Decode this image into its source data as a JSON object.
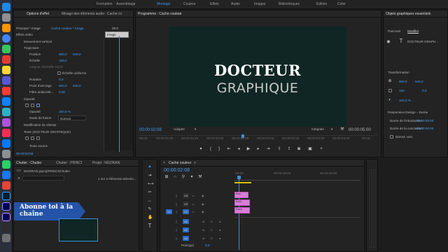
{
  "workspace": {
    "tabs": [
      "Formation",
      "Assemblage",
      "Montage",
      "Couleur",
      "Effets",
      "Audio",
      "Images",
      "Bibliothèques",
      "Edition",
      "Color"
    ],
    "active": "Montage"
  },
  "effect_controls": {
    "tabs": [
      "Options d'effet",
      "Mixage des éléments audio : Cache co"
    ],
    "source": "Principal * Image",
    "sequence": "Cache couleur * Image",
    "timecode_start": "00:0",
    "tooltip": "Image",
    "section": "Effets vidéo",
    "rows": [
      {
        "label": "Mouvement vertical",
        "value": ""
      },
      {
        "label": "Trajectoire",
        "value": ""
      },
      {
        "label": "Position",
        "value": "960,0",
        "value2": "540,0"
      },
      {
        "label": "Échelle",
        "value": "100,0",
        "value2": ""
      },
      {
        "label": "Largeur d'échelle 100,0",
        "value": "",
        "value2": ""
      },
      {
        "label": "",
        "value": "Échelle uniforme",
        "value2": ""
      },
      {
        "label": "Rotation",
        "value": "0,0",
        "value2": ""
      },
      {
        "label": "Point d'ancrage",
        "value": "960,0",
        "value2": "540,0"
      },
      {
        "label": "Filtre antiscintil...",
        "value": "0,00",
        "value2": ""
      },
      {
        "label": "Opacité",
        "value": "",
        "value2": ""
      },
      {
        "label": "Opacité",
        "value": "100,0 %",
        "value2": ""
      },
      {
        "label": "Mode de fusion",
        "value": "Normal",
        "value2": ""
      },
      {
        "label": "Modification de vitesse",
        "value": "",
        "value2": ""
      },
      {
        "label": "Texte (DOCTEUR GRAPHIQUE)",
        "value": "",
        "value2": ""
      },
      {
        "label": "Texte source",
        "value": "",
        "value2": ""
      }
    ],
    "footer_tc": "00:00:02:08"
  },
  "program": {
    "title": "Programme : Cache couleur",
    "menu_icon": "≡",
    "title_line1": "DOCTEUR",
    "title_line2": "GRAPHIQUE",
    "ruler": [
      "00:00",
      "00:00:01:00",
      "00:00:01:25",
      "00:00:02:00",
      "00:00:02:25",
      "00:00:03:00",
      "00:00:03:25",
      "00:00:04:00",
      "00:00:04:25",
      "00:00"
    ],
    "timecode": "00:00:02:08",
    "fit": "Adapter",
    "quality": "Intégrale",
    "duration": "00:00:05:00"
  },
  "project": {
    "tabs": [
      "Chutier : Chutier",
      "Chutier : PRINCI",
      "Projet : NGORAN"
    ],
    "path": "NGORAN.prproj\\PRINCI\\Chutier",
    "status": "1 sur 2 éléments sélectio...",
    "banner": "Abonne toi à la chaîne"
  },
  "timeline": {
    "title": "Cache couleur",
    "menu_icon": "≡",
    "timecode": "00:00:02:08",
    "ruler": [
      ":00:00",
      "00:00:15:00",
      "00:00:30:00"
    ],
    "tracks": [
      {
        "name": "V3"
      },
      {
        "name": "V2"
      },
      {
        "name": "V1"
      },
      {
        "name": "A1"
      },
      {
        "name": "A2"
      },
      {
        "name": "A3"
      }
    ],
    "master": "Principal",
    "master_val": "0,0",
    "clips": [
      "Doc",
      "DOC",
      "Cach"
    ]
  },
  "essential_graphics": {
    "title": "Objets graphiques essentiels",
    "tabs": [
      "Parcourir",
      "Modifier"
    ],
    "layer": "DOCTEUR GRAPH...",
    "section": "Transformation",
    "pos_x": "960,0",
    "pos_y": "540,0",
    "rot": "0,0",
    "opacity": "100,0 %",
    "scale": "100",
    "responsive": "Responsive Design – Durée",
    "intro_label": "Durée de l'introduction",
    "intro_val": "00:00:00:00",
    "outro_label": "Durée de la conclusion",
    "outro_val": "00:00:00:00",
    "roll_label": "Déroul. vert."
  },
  "colors": {
    "accent": "#3a8fe0",
    "clip": "#d77fd6",
    "banner": "#2553a8"
  }
}
